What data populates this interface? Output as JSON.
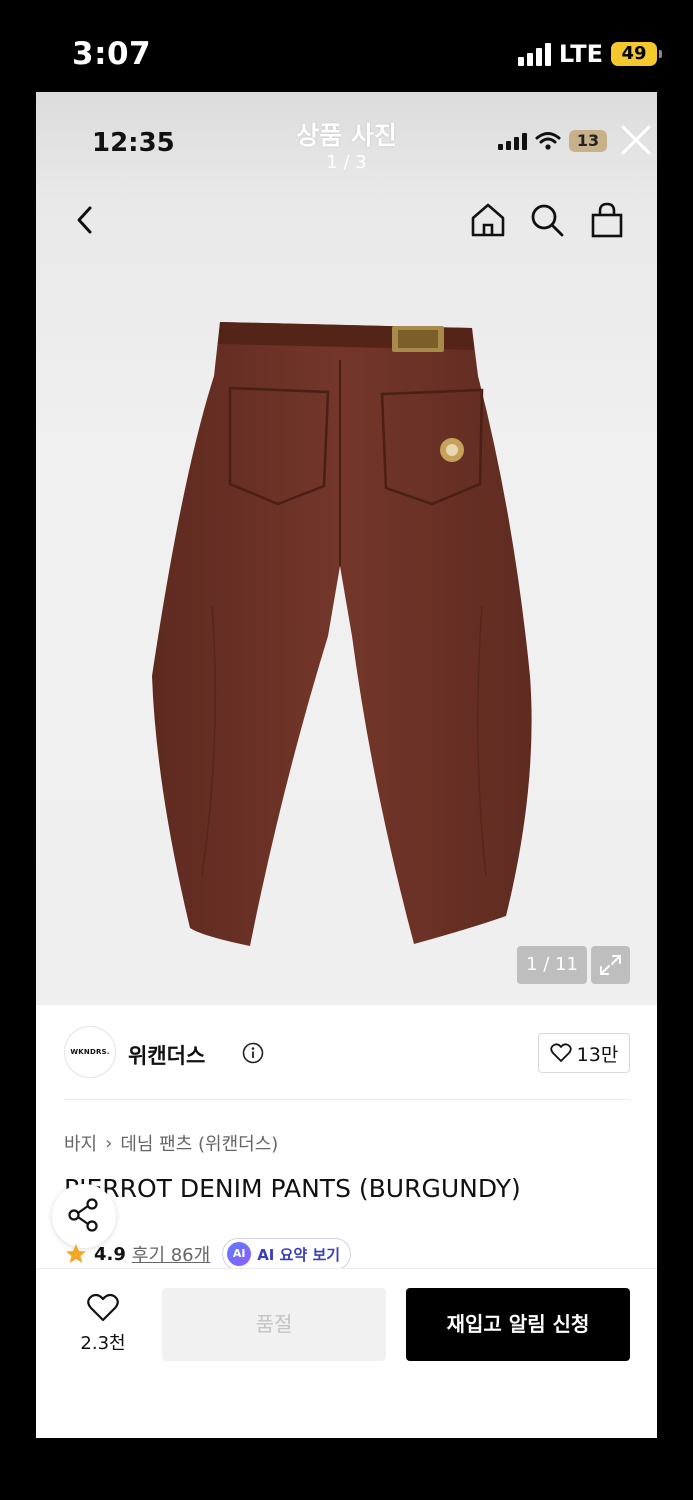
{
  "outer_status": {
    "time": "3:07",
    "network": "LTE",
    "battery": "49"
  },
  "viewer": {
    "title": "상품 사진",
    "count": "1 / 3"
  },
  "inner_status": {
    "time": "12:35",
    "battery": "13"
  },
  "photo": {
    "counter": "1 / 11"
  },
  "brand": {
    "logo_text": "WKNDRS.",
    "name": "위캔더스",
    "likes": "13만"
  },
  "breadcrumb": {
    "category": "바지",
    "separator": "›",
    "subcategory": "데님 팬츠 (위캔더스)"
  },
  "product": {
    "title": "PIERROT DENIM PANTS (BURGUNDY)"
  },
  "rating": {
    "score": "4.9",
    "reviews": "후기 86개",
    "ai_badge": "AI",
    "ai_label": "AI 요약 보기"
  },
  "bottom": {
    "wish_count": "2.3천",
    "soldout": "품절",
    "restock": "재입고 알림 신청"
  },
  "colors": {
    "accent": "#000000",
    "star": "#f5a623",
    "pants": "#6a2f23",
    "ai": "#3a3fb8"
  }
}
